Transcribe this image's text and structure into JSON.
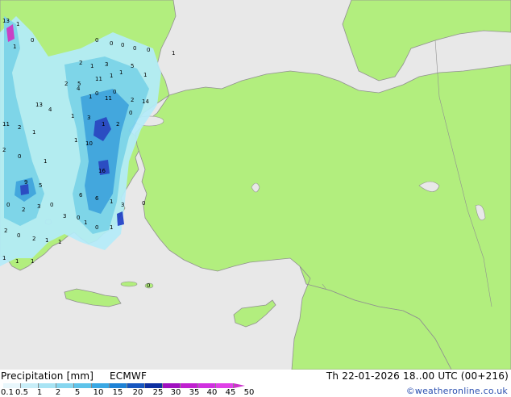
{
  "map": {
    "colors": {
      "sea": "#e8e8e8",
      "land": "#b2ee7e",
      "border": "#909090",
      "precip_light": "#b4ecfa",
      "precip_mid": "#7ad3f2",
      "precip_heavy": "#3aa2e6",
      "precip_dark": "#2040c8",
      "precip_extreme": "#cc33cc"
    },
    "precip_values": [
      "13",
      "1",
      "1",
      "0",
      "0",
      "0",
      "0",
      "0",
      "0",
      "1",
      "2",
      "1",
      "3",
      "5",
      "1",
      "1",
      "1",
      "11",
      "5",
      "2",
      "0",
      "0",
      "1",
      "4",
      "11",
      "2",
      "14",
      "13",
      "4",
      "11",
      "2",
      "1",
      "10",
      "1",
      "1",
      "0",
      "2",
      "3",
      "1",
      "2",
      "0",
      "1",
      "9",
      "16",
      "5",
      "0",
      "3",
      "0",
      "2",
      "6",
      "6",
      "1",
      "3",
      "0",
      "2",
      "0",
      "2",
      "1",
      "1",
      "3",
      "0",
      "1",
      "0",
      "1",
      "1",
      "1",
      "1",
      "0"
    ]
  },
  "legend": {
    "title": "Precipitation [mm]",
    "model": "ECMWF",
    "ticks": [
      "0.1",
      "0.5",
      "1",
      "2",
      "5",
      "10",
      "15",
      "20",
      "25",
      "30",
      "35",
      "40",
      "45",
      "50"
    ],
    "colors": [
      "#e8f7fc",
      "#c8eef8",
      "#a8e4f4",
      "#86d6ef",
      "#5ec3ea",
      "#3aa8e4",
      "#1e82d6",
      "#1656c0",
      "#0c2ea0",
      "#a010c0",
      "#c020d0",
      "#d030e0",
      "#e040e8",
      "#cc33cc"
    ]
  },
  "datetime": "Th 22-01-2026 18..00 UTC (00+216)",
  "credit": "©weatheronline.co.uk"
}
